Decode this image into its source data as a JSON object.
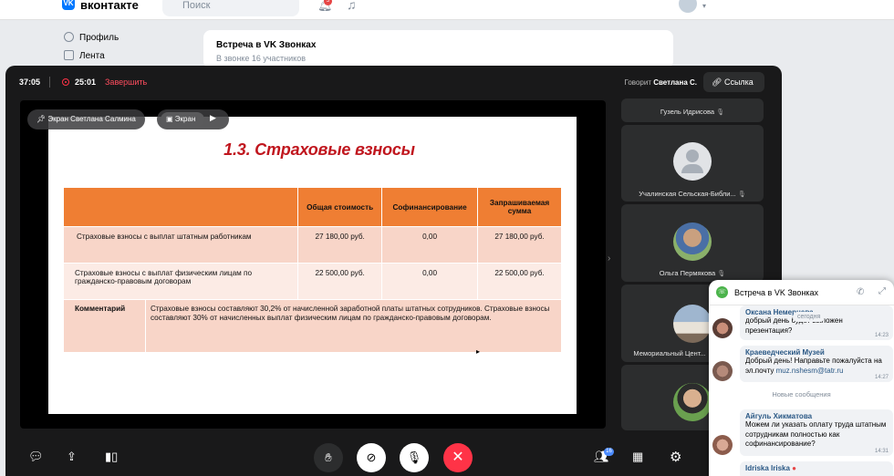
{
  "vk": {
    "logo_text": "вконтакте",
    "search_placeholder": "Поиск",
    "notif_count": "5",
    "nav": {
      "profile": "Профиль",
      "feed": "Лента"
    },
    "post": {
      "title": "Встреча в VK Звонках",
      "subtitle": "В звонке 16 участников"
    }
  },
  "call": {
    "duration": "37:05",
    "record_time": "25:01",
    "stop_label": "Завершить",
    "speaking_prefix": "Говорит",
    "speaking_name": "Светлана С.",
    "link_label": "Ссылка",
    "pill_screen_owner": "Экран Светлана Салмина",
    "pill_screen_label": "Экран",
    "participants_badge": "16",
    "participants": [
      {
        "name": "Гузель Идрисова"
      },
      {
        "name": "Учалинская Сельская-Библи..."
      },
      {
        "name": "Ольга Пермякова"
      },
      {
        "name": "Мемориальный Цент..."
      }
    ]
  },
  "slide": {
    "title": "1.3. Страховые взносы",
    "headers": [
      "",
      "Общая стоимость",
      "Софинансирование",
      "Запрашиваемая сумма"
    ],
    "rows": [
      {
        "label": "Страховые взносы с выплат штатным работникам",
        "total": "27 180,00 руб.",
        "cofin": "0,00",
        "requested": "27 180,00 руб."
      },
      {
        "label": "Страховые взносы с выплат физическим лицам по гражданско-правовым договорам",
        "total": "22 500,00 руб.",
        "cofin": "0,00",
        "requested": "22 500,00 руб."
      }
    ],
    "comment_label": "Комментарий",
    "comment_text": "Страховые взносы составляют 30,2% от начисленной заработной платы штатных сотрудников. Страховые взносы составляют 30% от начисленных выплат физическим лицам по гражданско-правовым договорам."
  },
  "chat": {
    "title": "Встреча в VK Звонках",
    "today": "сегодня",
    "new_messages": "Новые сообщения",
    "messages": [
      {
        "name": "Оксана Немерцева",
        "text": "добрый день будет выложен презентация?",
        "time": "14:23"
      },
      {
        "name": "Краеведческий Музей",
        "text": "Добрый день! Направьте пожалуйста на эл.почту",
        "link": "muz.nshesm@tatr.ru",
        "time": "14:27"
      },
      {
        "name": "Айгуль Хикматова",
        "text": "Можем ли указать оплату труда штатным сотрудникам полностью как софинансирование?",
        "time": "14:31"
      },
      {
        "name": "Idriska Iriska",
        "text": "",
        "time": ""
      }
    ]
  },
  "colors": {
    "accent": "#0077ff",
    "danger": "#e64646",
    "slide_header": "#ef7e33",
    "slide_title": "#c0161e"
  }
}
